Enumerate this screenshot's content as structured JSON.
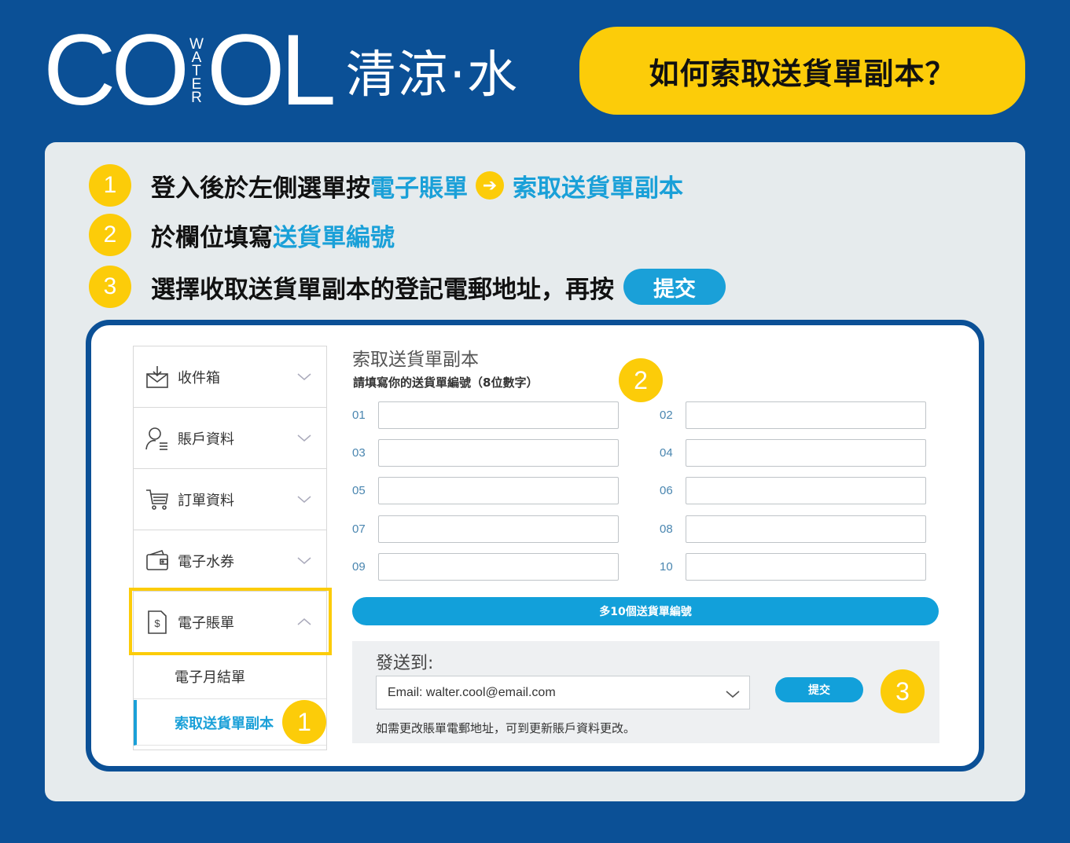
{
  "brand": {
    "logo_co": "CO",
    "logo_water": [
      "W",
      "A",
      "T",
      "E",
      "R"
    ],
    "logo_ol": "OL",
    "logo_chinese": "清涼·水"
  },
  "title": "如何索取送貨單副本？",
  "steps": [
    {
      "num": "1",
      "text_a": "登入後於左側選單按",
      "hl_a": "電子賬單",
      "hl_b": "索取送貨單副本"
    },
    {
      "num": "2",
      "text_a": "於欄位填寫",
      "hl_a": "送貨單編號"
    },
    {
      "num": "3",
      "text_a": "選擇收取送貨單副本的登記電郵地址，再按",
      "button": "提交"
    }
  ],
  "sidebar": {
    "items": [
      {
        "label": "收件箱",
        "icon": "inbox-icon"
      },
      {
        "label": "賬戶資料",
        "icon": "user-icon"
      },
      {
        "label": "訂單資料",
        "icon": "cart-icon"
      },
      {
        "label": "電子水券",
        "icon": "wallet-icon"
      },
      {
        "label": "電子賬單",
        "icon": "bill-icon"
      }
    ],
    "sub_items": [
      {
        "label": "電子月結單"
      },
      {
        "label": "索取送貨單副本"
      }
    ]
  },
  "form": {
    "title": "索取送貨單副本",
    "subtitle": "請填寫你的送貨單編號（8位數字）",
    "fields": [
      "01",
      "02",
      "03",
      "04",
      "05",
      "06",
      "07",
      "08",
      "09",
      "10"
    ],
    "more_button": "多10個送貨單編號"
  },
  "send": {
    "title": "發送到:",
    "email_prefix": "Email: ",
    "email_value": "walter.cool@email.com",
    "submit": "提交",
    "note": "如需更改賬單電郵地址，可到更新賬戶資料更改。"
  },
  "badges": {
    "b1": "1",
    "b2": "2",
    "b3": "3"
  },
  "colors": {
    "background": "#0b5096",
    "accent_yellow": "#fccc09",
    "accent_blue": "#1aa0d8",
    "panel": "#e6ebed"
  }
}
